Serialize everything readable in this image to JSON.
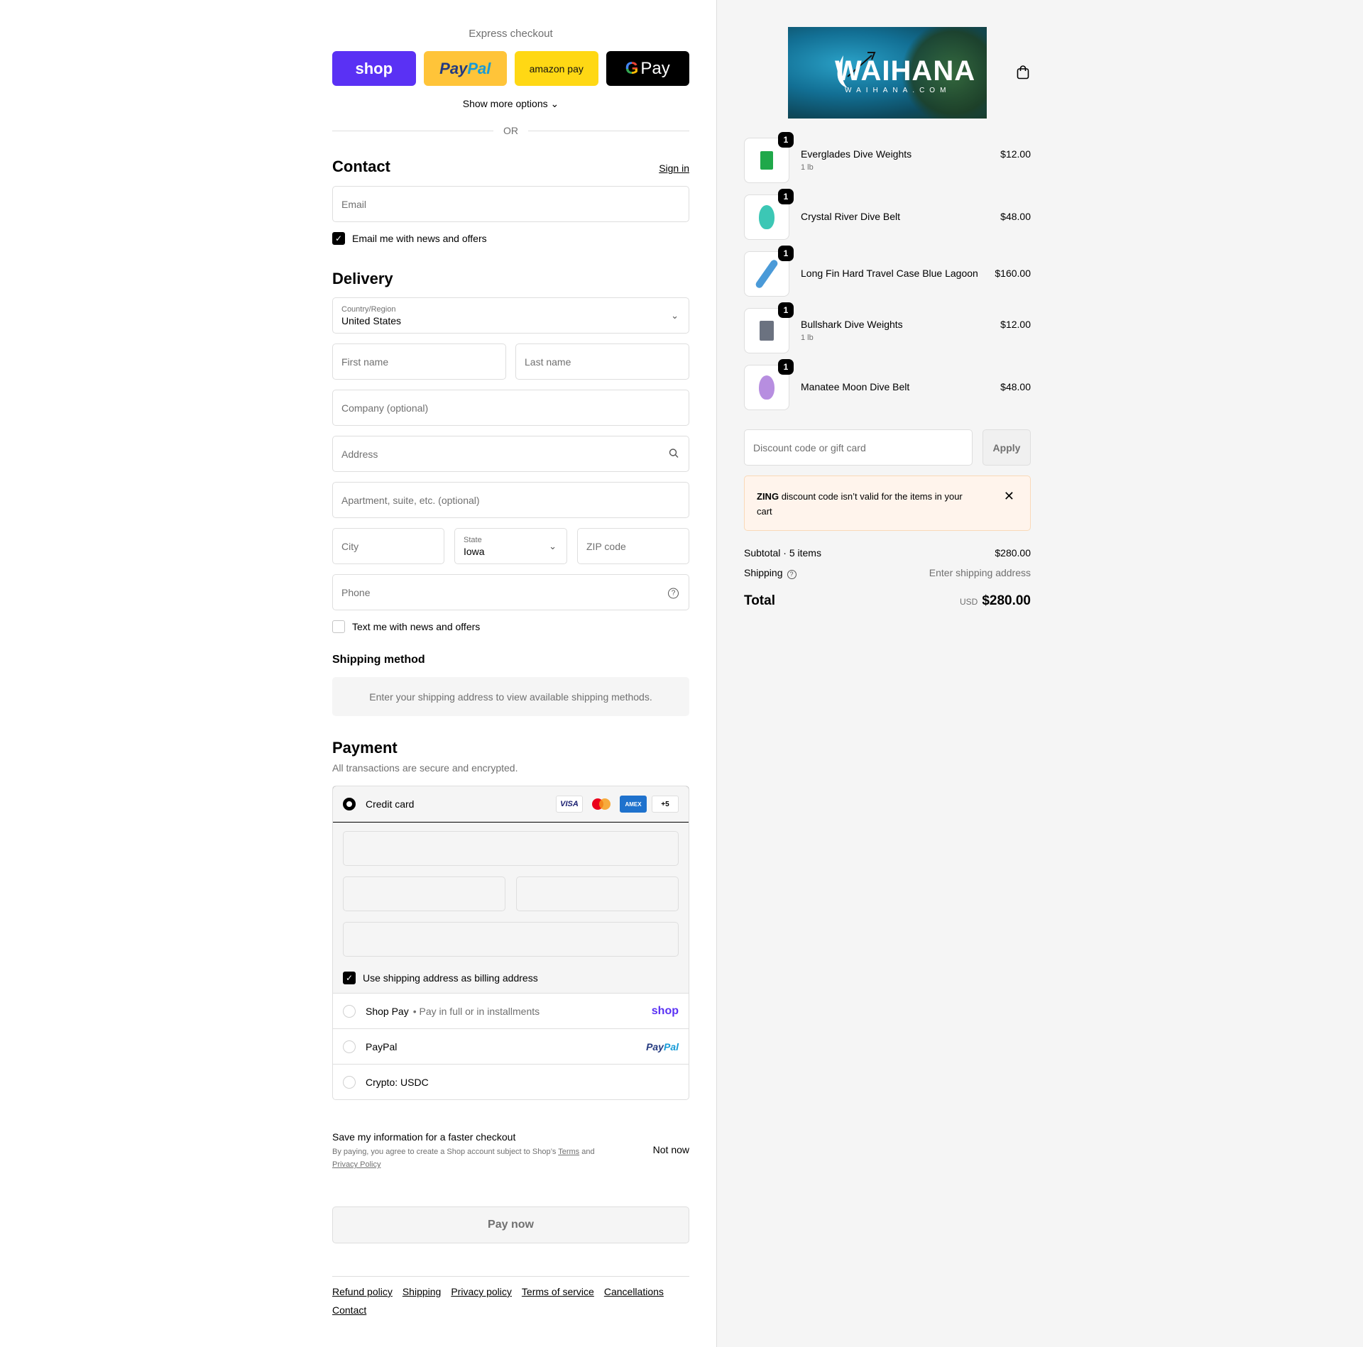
{
  "express": {
    "label": "Express checkout",
    "shop": "shop",
    "paypal_a": "Pay",
    "paypal_b": "Pal",
    "amazon": "amazon pay",
    "gpay_g": "G",
    "gpay": "Pay",
    "more_options": "Show more options ⌄",
    "or": "OR"
  },
  "contact": {
    "title": "Contact",
    "sign_in": "Sign in",
    "email_placeholder": "Email",
    "news_label": "Email me with news and offers",
    "news_checked": true
  },
  "delivery": {
    "title": "Delivery",
    "country_label": "Country/Region",
    "country_value": "United States",
    "first_name": "First name",
    "last_name": "Last name",
    "company": "Company (optional)",
    "address": "Address",
    "apartment": "Apartment, suite, etc. (optional)",
    "city": "City",
    "state_label": "State",
    "state_value": "Iowa",
    "zip": "ZIP code",
    "phone": "Phone",
    "text_label": "Text me with news and offers",
    "text_checked": false
  },
  "shipping_method": {
    "title": "Shipping method",
    "info": "Enter your shipping address to view available shipping methods."
  },
  "payment": {
    "title": "Payment",
    "subtitle": "All transactions are secure and encrypted.",
    "credit_card": "Credit card",
    "visa": "VISA",
    "amex": "AMEX",
    "more_cards": "+5",
    "billing_label": "Use shipping address as billing address",
    "billing_checked": true,
    "shop_pay": "Shop Pay",
    "shop_pay_sub": "• Pay in full or in installments",
    "shop_brand": "shop",
    "paypal": "PayPal",
    "paypal_brand_a": "Pay",
    "paypal_brand_b": "Pal",
    "crypto": "Crypto: USDC",
    "selected": "credit_card"
  },
  "save": {
    "title": "Save my information for a faster checkout",
    "text_a": "By paying, you agree to create a Shop account subject to Shop’s",
    "terms": "Terms",
    "and": "and",
    "privacy": "Privacy Policy",
    "not_now": "Not now"
  },
  "pay_now": "Pay now",
  "footer": {
    "links": [
      "Refund policy",
      "Shipping",
      "Privacy policy",
      "Terms of service",
      "Cancellations",
      "Contact"
    ]
  },
  "store": {
    "logo_text": "WAIHANA",
    "logo_sub": "WAIHANA.COM"
  },
  "cart": {
    "items": [
      {
        "name": "Everglades Dive Weights",
        "variant": "1 lb",
        "price": "$12.00",
        "qty": "1",
        "color": "#1fa84a"
      },
      {
        "name": "Crystal River Dive Belt",
        "variant": "",
        "price": "$48.00",
        "qty": "1",
        "color": "#3cc7b5"
      },
      {
        "name": "Long Fin Hard Travel Case Blue Lagoon",
        "variant": "",
        "price": "$160.00",
        "qty": "1",
        "color": "#4a9ad8"
      },
      {
        "name": "Bullshark Dive Weights",
        "variant": "1 lb",
        "price": "$12.00",
        "qty": "1",
        "color": "#6b7280"
      },
      {
        "name": "Manatee Moon Dive Belt",
        "variant": "",
        "price": "$48.00",
        "qty": "1",
        "color": "#b78ee0"
      }
    ]
  },
  "discount": {
    "placeholder": "Discount code or gift card",
    "apply": "Apply",
    "alert_code": "ZING",
    "alert_text": "discount code isn’t valid for the items in your cart"
  },
  "summary": {
    "subtotal_label": "Subtotal · 5 items",
    "subtotal_value": "$280.00",
    "shipping_label": "Shipping",
    "shipping_value": "Enter shipping address",
    "total_label": "Total",
    "currency": "USD",
    "total_value": "$280.00"
  }
}
